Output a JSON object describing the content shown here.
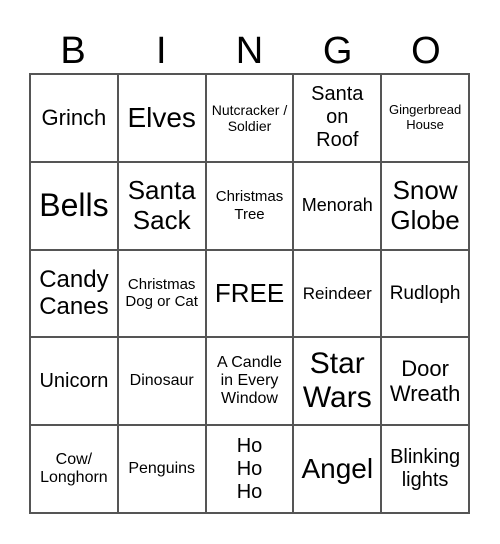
{
  "header": [
    "B",
    "I",
    "N",
    "G",
    "O"
  ],
  "cells": [
    "Grinch",
    "Elves",
    "Nutcracker / Soldier",
    "Santa on Roof",
    "Gingerbread House",
    "Bells",
    "Santa Sack",
    "Christmas Tree",
    "Menorah",
    "Snow Globe",
    "Candy Canes",
    "Christmas Dog or Cat",
    "FREE",
    "Reindeer",
    "Rudloph",
    "Unicorn",
    "Dinosaur",
    "A Candle in Every Window",
    "Star Wars",
    "Door Wreath",
    "Cow/ Longhorn",
    "Penguins",
    "Ho Ho Ho",
    "Angel",
    "Blinking lights"
  ]
}
